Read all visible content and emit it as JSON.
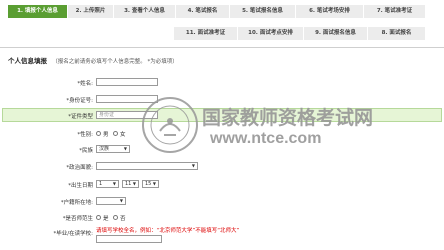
{
  "steps_row1": [
    {
      "label": "1. 填报个人信息",
      "active": true
    },
    {
      "label": "2. 上传照片",
      "active": false
    },
    {
      "label": "3. 查看个人信息",
      "active": false
    },
    {
      "label": "4. 笔试报名",
      "active": false
    },
    {
      "label": "5. 笔试报名信息",
      "active": false
    },
    {
      "label": "6. 笔试考场安排",
      "active": false
    },
    {
      "label": "7. 笔试准考证",
      "active": false
    }
  ],
  "steps_row2": [
    {
      "label": "11. 面试准考证"
    },
    {
      "label": "10. 面试考点安排"
    },
    {
      "label": "9. 面试报名信息"
    },
    {
      "label": "8. 面试报名"
    }
  ],
  "section": {
    "title": "个人信息填报",
    "note": "（报名之前请务必填写个人信息完整。 *为必填项）"
  },
  "fields": {
    "name": "*姓名:",
    "id_number": "*身份证号:",
    "id_type": "*证件类型",
    "id_type_value": "身份证",
    "gender": "*性别:",
    "gender_male": "男",
    "gender_female": "女",
    "ethnicity": "*民族",
    "ethnicity_value": "汉族",
    "political": "*政治面貌:",
    "birth_date": "*出生日期",
    "birth_year": "1",
    "birth_month": "11",
    "birth_day": "15",
    "hukou": "*户籍所在地:",
    "normal_student": "*是否师范生",
    "normal_yes": "是",
    "normal_no": "否",
    "school": "*毕业/在读学校:",
    "school_hint": "请填写学校全名，例如：“北京师范大学”不能填写“北师大”"
  },
  "watermark": {
    "cn": "国家教师资格考试网",
    "url": "www.ntce.com"
  }
}
